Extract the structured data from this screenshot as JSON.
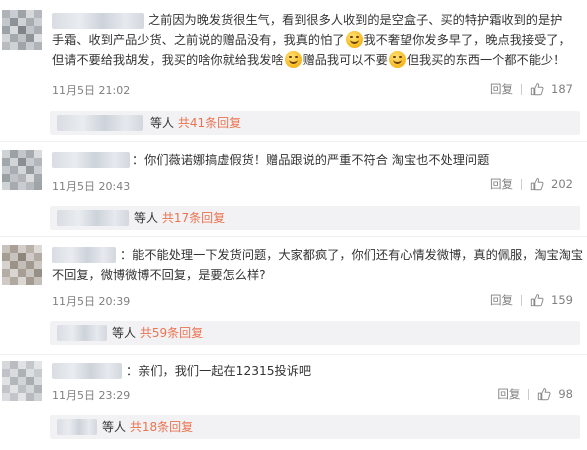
{
  "comments": [
    {
      "text_line1": "之前因为晚发货很生气，看到很多人收到的是空盒子、买的特护霜收到的是护",
      "text_line2": "手霜、收到产品少货、之前说的赠品没有，我真的怕了",
      "text_line2_b": "我不奢望你发多早了，晚点我接受了，",
      "text_line3_a": "但请不要给我胡发，我买的啥你就给我发啥",
      "text_line3_b": "赠品我可以不要",
      "text_line3_c": "但我买的东西一个都不能少！",
      "time": "11月5日 21:02",
      "reply_label": "回复",
      "likes": "187",
      "replies_prefix": "等人",
      "replies_link": "共41条回复"
    },
    {
      "text_line1": "：你们薇诺娜搞虚假货！赠品跟说的严重不符合 淘宝也不处理问题",
      "time": "11月5日 20:43",
      "reply_label": "回复",
      "likes": "202",
      "replies_prefix": "等人",
      "replies_link": "共17条回复"
    },
    {
      "text_line1": "：能不能处理一下发货问题，大家都疯了，你们还有心情发微博，真的佩服，淘宝淘宝",
      "text_line2": "不回复，微博微博不回复，是要怎么样?",
      "time": "11月5日 20:39",
      "reply_label": "回复",
      "likes": "159",
      "replies_prefix": "等人",
      "replies_link": "共59条回复"
    },
    {
      "text_line1": "：亲们，我们一起在12315投诉吧",
      "time": "11月5日 23:29",
      "reply_label": "回复",
      "likes": "98",
      "replies_prefix": "等人",
      "replies_link": "共18条回复"
    }
  ],
  "colors": {
    "link": "#eb7350",
    "muted": "#808080",
    "reply_bg": "#f2f2f5"
  },
  "icons": {
    "like": "thumbs-up-icon",
    "emoji": "smile-emoji-icon"
  }
}
